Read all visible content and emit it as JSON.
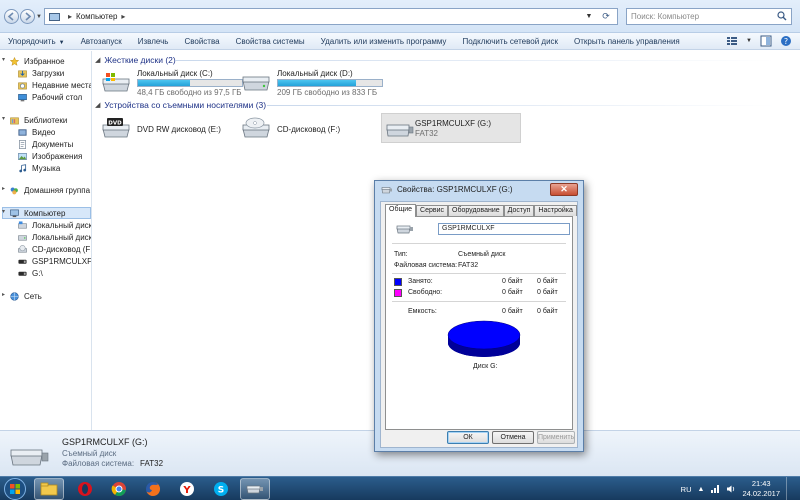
{
  "window": {
    "address": "Компьютер",
    "search_placeholder": "Поиск: Компьютер"
  },
  "toolbar": {
    "items": [
      "Упорядочить",
      "Автозапуск",
      "Извлечь",
      "Свойства",
      "Свойства системы",
      "Удалить или изменить программу",
      "Подключить сетевой диск",
      "Открыть панель управления"
    ]
  },
  "sidebar": {
    "favorites": "Избранное",
    "downloads": "Загрузки",
    "recent": "Недавние места",
    "desktop": "Рабочий стол",
    "libraries": "Библиотеки",
    "video": "Видео",
    "documents": "Документы",
    "images": "Изображения",
    "music": "Музыка",
    "homegroup": "Домашняя группа",
    "computer": "Компьютер",
    "disk_c": "Локальный диск (C:)",
    "disk_d": "Локальный диск (D:)",
    "cd_f": "CD-дисковод (F:)",
    "usb_g": "GSP1RMCULXF (G:)",
    "g": "G:\\",
    "network": "Сеть"
  },
  "main": {
    "hard_disks_header": "Жесткие диски (2)",
    "removable_header": "Устройства со съемными носителями (3)",
    "drives": [
      {
        "name": "Локальный диск (C:)",
        "free": "48,4 ГБ свободно из 97,5 ГБ",
        "used_fraction": 0.5
      },
      {
        "name": "Локальный диск (D:)",
        "free": "209 ГБ свободно из 833 ГБ",
        "used_fraction": 0.75
      }
    ],
    "removable": [
      {
        "name": "DVD RW дисковод (E:)"
      },
      {
        "name": "CD-дисковод (F:)"
      },
      {
        "name": "GSP1RMCULXF (G:)",
        "fs": "FAT32"
      }
    ]
  },
  "details": {
    "name": "GSP1RMCULXF (G:)",
    "type": "Съемный диск",
    "fs_label": "Файловая система:",
    "fs_value": "FAT32"
  },
  "dialog": {
    "title": "Свойства: GSP1RMCULXF (G:)",
    "tabs": [
      "Общие",
      "Сервис",
      "Оборудование",
      "Доступ",
      "Настройка"
    ],
    "label_value": "GSP1RMCULXF",
    "type_label": "Тип:",
    "type_value": "Съемный диск",
    "fs_label": "Файловая система:",
    "fs_value": "FAT32",
    "used_label": "Занято:",
    "used_bytes": "0 байт",
    "used_size": "0 байт",
    "free_label": "Свободно:",
    "free_bytes": "0 байт",
    "free_size": "0 байт",
    "capacity_label": "Емкость:",
    "capacity_bytes": "0 байт",
    "capacity_size": "0 байт",
    "disk_label": "Диск G:",
    "ok": "ОК",
    "cancel": "Отмена",
    "apply": "Применить",
    "colors": {
      "used": "#0000ff",
      "free": "#ff00ff"
    }
  },
  "taskbar": {
    "lang": "RU",
    "time": "21:43",
    "date": "24.02.2017"
  }
}
